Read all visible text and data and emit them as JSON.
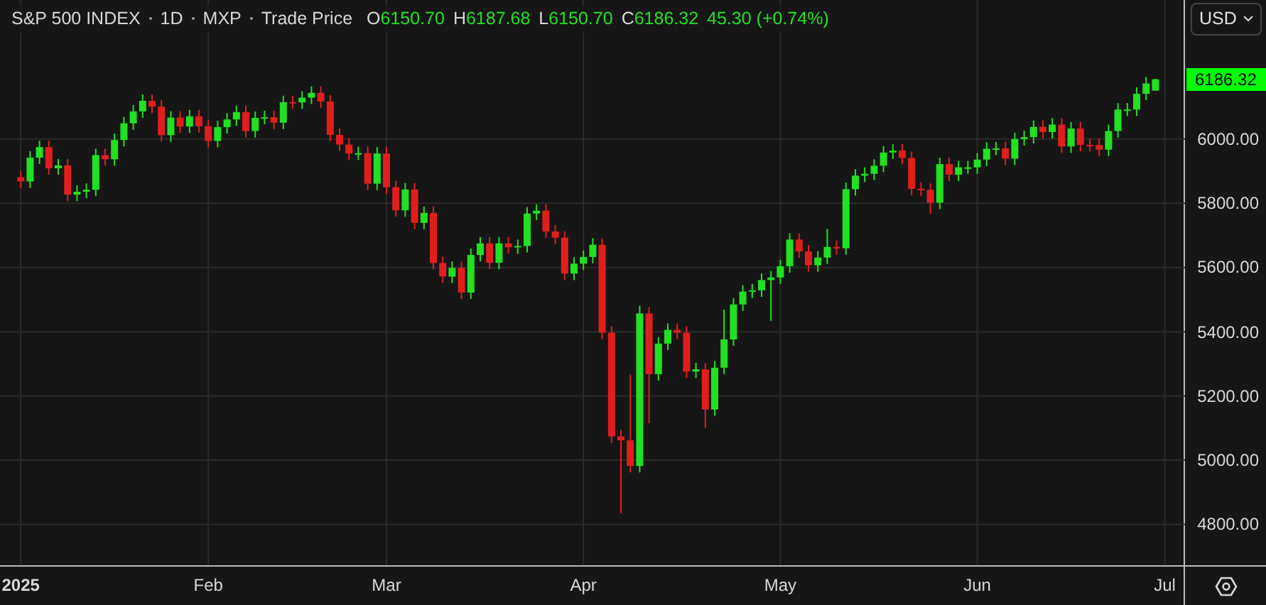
{
  "header": {
    "symbol": "S&P 500 INDEX",
    "interval": "1D",
    "exchange": "MXP",
    "price_type": "Trade Price",
    "open_label": "O",
    "open": "6150.70",
    "high_label": "H",
    "high": "6187.68",
    "low_label": "L",
    "low": "6150.70",
    "close_label": "C",
    "close": "6186.32",
    "change": "45.30 (+0.74%)"
  },
  "currency": "USD",
  "last_price_tag": "6186.32",
  "chart_data": {
    "type": "candlestick",
    "grid": true,
    "ylim": [
      4673,
      6433
    ],
    "yticks": [
      {
        "value": 4800,
        "label": "4800.00"
      },
      {
        "value": 5000,
        "label": "5000.00"
      },
      {
        "value": 5200,
        "label": "5200.00"
      },
      {
        "value": 5400,
        "label": "5400.00"
      },
      {
        "value": 5600,
        "label": "5600.00"
      },
      {
        "value": 5800,
        "label": "5800.00"
      },
      {
        "value": 6000,
        "label": "6000.00"
      }
    ],
    "categories": [
      "2025",
      null,
      null,
      null,
      null,
      null,
      null,
      null,
      null,
      null,
      null,
      null,
      null,
      null,
      null,
      null,
      null,
      null,
      null,
      null,
      "Feb",
      null,
      null,
      null,
      null,
      null,
      null,
      null,
      null,
      null,
      null,
      null,
      null,
      null,
      null,
      null,
      null,
      null,
      null,
      "Mar",
      null,
      null,
      null,
      null,
      null,
      null,
      null,
      null,
      null,
      null,
      null,
      null,
      null,
      null,
      null,
      null,
      null,
      null,
      null,
      null,
      "Apr",
      null,
      null,
      null,
      null,
      null,
      null,
      null,
      null,
      null,
      null,
      null,
      null,
      null,
      null,
      null,
      null,
      null,
      null,
      null,
      null,
      "May",
      null,
      null,
      null,
      null,
      null,
      null,
      null,
      null,
      null,
      null,
      null,
      null,
      null,
      null,
      null,
      null,
      null,
      null,
      null,
      null,
      "Jun",
      null,
      null,
      null,
      null,
      null,
      null,
      null,
      null,
      null,
      null,
      null,
      null,
      null,
      null,
      null,
      null,
      null,
      null,
      null,
      "Jul"
    ],
    "ohlc": [
      [
        5881,
        5901,
        5848,
        5868
      ],
      [
        5868,
        5962,
        5848,
        5942
      ],
      [
        5942,
        5995,
        5922,
        5975
      ],
      [
        5975,
        5995,
        5889,
        5909
      ],
      [
        5909,
        5938,
        5889,
        5918
      ],
      [
        5918,
        5938,
        5807,
        5827
      ],
      [
        5827,
        5856,
        5807,
        5836
      ],
      [
        5836,
        5862,
        5816,
        5842
      ],
      [
        5842,
        5970,
        5822,
        5950
      ],
      [
        5950,
        5970,
        5917,
        5937
      ],
      [
        5937,
        6017,
        5917,
        5997
      ],
      [
        5997,
        6069,
        5977,
        6049
      ],
      [
        6049,
        6106,
        6029,
        6086
      ],
      [
        6086,
        6139,
        6066,
        6119
      ],
      [
        6119,
        6139,
        6081,
        6101
      ],
      [
        6101,
        6121,
        5992,
        6012
      ],
      [
        6012,
        6087,
        5992,
        6067
      ],
      [
        6067,
        6087,
        6019,
        6039
      ],
      [
        6039,
        6091,
        6019,
        6071
      ],
      [
        6071,
        6091,
        6020,
        6040
      ],
      [
        6040,
        6060,
        5974,
        5994
      ],
      [
        5994,
        6057,
        5974,
        6037
      ],
      [
        6037,
        6081,
        6017,
        6061
      ],
      [
        6061,
        6104,
        6041,
        6084
      ],
      [
        6084,
        6104,
        6005,
        6025
      ],
      [
        6025,
        6086,
        6005,
        6066
      ],
      [
        6066,
        6088,
        6046,
        6068
      ],
      [
        6068,
        6088,
        6031,
        6051
      ],
      [
        6051,
        6135,
        6031,
        6115
      ],
      [
        6115,
        6135,
        6094,
        6114
      ],
      [
        6114,
        6149,
        6094,
        6129
      ],
      [
        6129,
        6164,
        6109,
        6144
      ],
      [
        6144,
        6164,
        6097,
        6117
      ],
      [
        6117,
        6137,
        5993,
        6013
      ],
      [
        6013,
        6033,
        5963,
        5983
      ],
      [
        5983,
        6003,
        5935,
        5955
      ],
      [
        5955,
        5976,
        5935,
        5956
      ],
      [
        5956,
        5976,
        5841,
        5861
      ],
      [
        5861,
        5975,
        5841,
        5955
      ],
      [
        5955,
        5975,
        5830,
        5850
      ],
      [
        5850,
        5870,
        5758,
        5778
      ],
      [
        5778,
        5863,
        5758,
        5843
      ],
      [
        5843,
        5863,
        5719,
        5739
      ],
      [
        5739,
        5790,
        5719,
        5770
      ],
      [
        5770,
        5790,
        5594,
        5614
      ],
      [
        5614,
        5634,
        5552,
        5572
      ],
      [
        5572,
        5619,
        5552,
        5599
      ],
      [
        5599,
        5619,
        5502,
        5522
      ],
      [
        5522,
        5659,
        5502,
        5639
      ],
      [
        5639,
        5695,
        5619,
        5675
      ],
      [
        5675,
        5695,
        5595,
        5615
      ],
      [
        5615,
        5695,
        5595,
        5675
      ],
      [
        5675,
        5695,
        5643,
        5663
      ],
      [
        5663,
        5687,
        5643,
        5667
      ],
      [
        5667,
        5788,
        5647,
        5768
      ],
      [
        5768,
        5797,
        5748,
        5777
      ],
      [
        5777,
        5797,
        5692,
        5712
      ],
      [
        5712,
        5732,
        5673,
        5693
      ],
      [
        5693,
        5713,
        5561,
        5581
      ],
      [
        5581,
        5632,
        5561,
        5612
      ],
      [
        5612,
        5653,
        5592,
        5633
      ],
      [
        5633,
        5691,
        5613,
        5671
      ],
      [
        5671,
        5691,
        5377,
        5397
      ],
      [
        5397,
        5417,
        5054,
        5074
      ],
      [
        5074,
        5094,
        4835,
        5062
      ],
      [
        5062,
        5267,
        4962,
        4982
      ],
      [
        4982,
        5481,
        4962,
        5457
      ],
      [
        5457,
        5477,
        5115,
        5268
      ],
      [
        5268,
        5383,
        5248,
        5363
      ],
      [
        5363,
        5426,
        5343,
        5406
      ],
      [
        5406,
        5426,
        5377,
        5397
      ],
      [
        5397,
        5417,
        5256,
        5276
      ],
      [
        5276,
        5303,
        5256,
        5283
      ],
      [
        5283,
        5303,
        5101,
        5158
      ],
      [
        5158,
        5308,
        5138,
        5288
      ],
      [
        5288,
        5469,
        5268,
        5376
      ],
      [
        5376,
        5505,
        5356,
        5485
      ],
      [
        5485,
        5545,
        5465,
        5525
      ],
      [
        5525,
        5549,
        5505,
        5529
      ],
      [
        5529,
        5581,
        5509,
        5561
      ],
      [
        5561,
        5589,
        5434,
        5569
      ],
      [
        5569,
        5624,
        5549,
        5604
      ],
      [
        5604,
        5707,
        5584,
        5687
      ],
      [
        5687,
        5707,
        5630,
        5650
      ],
      [
        5650,
        5670,
        5587,
        5607
      ],
      [
        5607,
        5651,
        5587,
        5631
      ],
      [
        5631,
        5720,
        5611,
        5664
      ],
      [
        5664,
        5684,
        5640,
        5660
      ],
      [
        5660,
        5864,
        5640,
        5844
      ],
      [
        5844,
        5906,
        5824,
        5886
      ],
      [
        5886,
        5912,
        5866,
        5892
      ],
      [
        5892,
        5937,
        5872,
        5917
      ],
      [
        5917,
        5978,
        5897,
        5958
      ],
      [
        5958,
        5984,
        5938,
        5964
      ],
      [
        5964,
        5984,
        5921,
        5941
      ],
      [
        5941,
        5961,
        5825,
        5845
      ],
      [
        5845,
        5865,
        5822,
        5842
      ],
      [
        5842,
        5862,
        5767,
        5802
      ],
      [
        5802,
        5942,
        5782,
        5922
      ],
      [
        5922,
        5942,
        5869,
        5889
      ],
      [
        5889,
        5932,
        5869,
        5912
      ],
      [
        5912,
        5932,
        5892,
        5912
      ],
      [
        5912,
        5956,
        5892,
        5936
      ],
      [
        5936,
        5990,
        5916,
        5970
      ],
      [
        5970,
        5991,
        5950,
        5971
      ],
      [
        5971,
        5991,
        5919,
        5939
      ],
      [
        5939,
        6020,
        5919,
        6000
      ],
      [
        6000,
        6026,
        5980,
        6006
      ],
      [
        6006,
        6058,
        5986,
        6038
      ],
      [
        6038,
        6058,
        6002,
        6022
      ],
      [
        6022,
        6065,
        6002,
        6045
      ],
      [
        6045,
        6065,
        5957,
        5977
      ],
      [
        5977,
        6053,
        5957,
        6033
      ],
      [
        6033,
        6053,
        5962,
        5982
      ],
      [
        5982,
        6002,
        5961,
        5981
      ],
      [
        5981,
        6001,
        5947,
        5967
      ],
      [
        5967,
        6045,
        5947,
        6025
      ],
      [
        6025,
        6112,
        6005,
        6092
      ],
      [
        6092,
        6112,
        6072,
        6092
      ],
      [
        6092,
        6161,
        6072,
        6141
      ],
      [
        6141,
        6193,
        6121,
        6173
      ],
      [
        6150.7,
        6187.68,
        6150.7,
        6186.32
      ],
      null
    ]
  }
}
